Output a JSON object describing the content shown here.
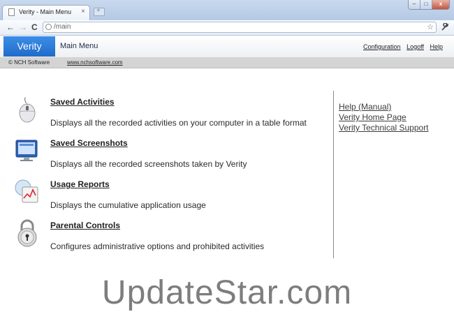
{
  "browser": {
    "tab_title": "Verity - Main Menu",
    "tab_close": "×",
    "new_tab": "+",
    "back": "←",
    "forward": "→",
    "reload": "C",
    "url": "/main",
    "star": "☆",
    "wrench": "🔧"
  },
  "header": {
    "brand": "Verity",
    "menu_label": "Main Menu",
    "links": [
      "Configuration",
      "Logoff",
      "Help"
    ]
  },
  "subheader": {
    "copyright": "© NCH Software",
    "website": "www.nchsoftware.com"
  },
  "items": [
    {
      "title": "Saved Activities",
      "desc": "Displays all the recorded activities on your computer in a table format",
      "icon": "mouse-icon"
    },
    {
      "title": "Saved Screenshots",
      "desc": "Displays all the recorded screenshots taken by Verity",
      "icon": "monitor-icon"
    },
    {
      "title": "Usage Reports",
      "desc": "Displays the cumulative application usage",
      "icon": "usage-report-icon"
    },
    {
      "title": "Parental Controls",
      "desc": "Configures administrative options and prohibited activities",
      "icon": "padlock-icon"
    }
  ],
  "sidebar_links": [
    "Help (Manual)",
    "Verity Home Page",
    "Verity Technical Support"
  ],
  "watermark": "UpdateStar.com"
}
